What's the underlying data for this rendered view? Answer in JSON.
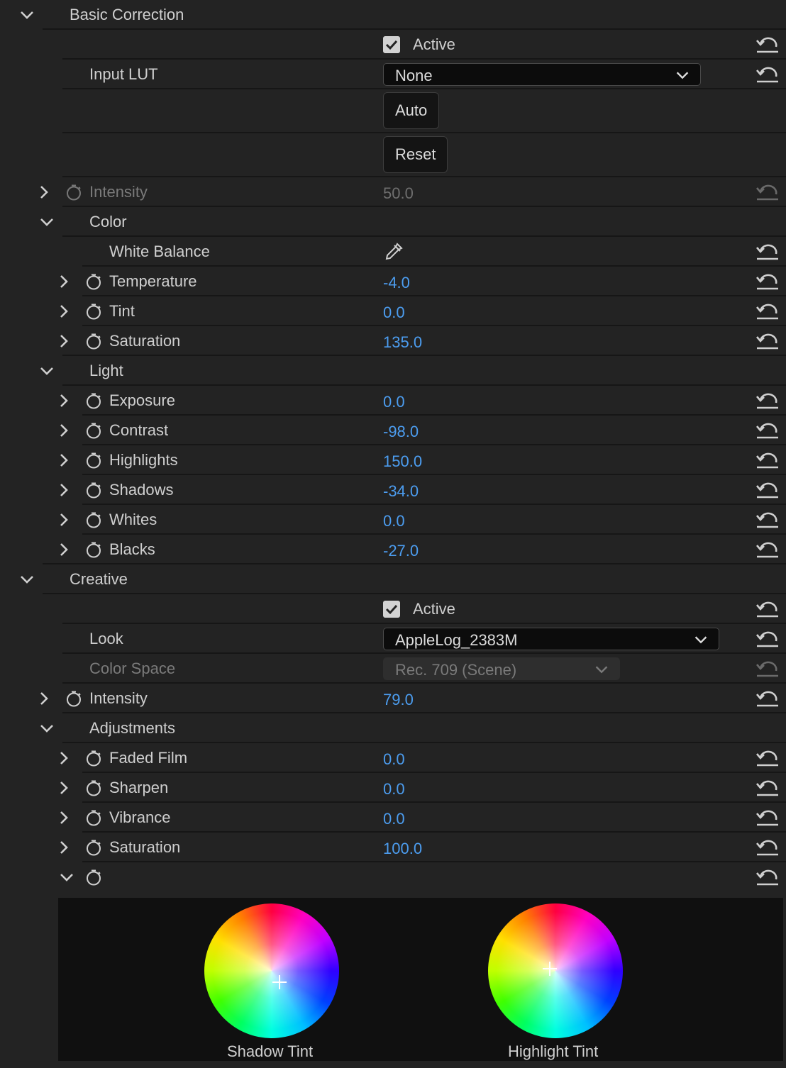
{
  "basic_correction": {
    "title": "Basic Correction",
    "active_label": "Active",
    "input_lut_label": "Input LUT",
    "input_lut_value": "None",
    "auto_label": "Auto",
    "reset_label": "Reset",
    "intensity_label": "Intensity",
    "intensity_value": "50.0",
    "color": {
      "title": "Color",
      "white_balance_label": "White Balance",
      "temperature_label": "Temperature",
      "temperature_value": "-4.0",
      "tint_label": "Tint",
      "tint_value": "0.0",
      "saturation_label": "Saturation",
      "saturation_value": "135.0"
    },
    "light": {
      "title": "Light",
      "exposure_label": "Exposure",
      "exposure_value": "0.0",
      "contrast_label": "Contrast",
      "contrast_value": "-98.0",
      "highlights_label": "Highlights",
      "highlights_value": "150.0",
      "shadows_label": "Shadows",
      "shadows_value": "-34.0",
      "whites_label": "Whites",
      "whites_value": "0.0",
      "blacks_label": "Blacks",
      "blacks_value": "-27.0"
    }
  },
  "creative": {
    "title": "Creative",
    "active_label": "Active",
    "look_label": "Look",
    "look_value": "AppleLog_2383M",
    "color_space_label": "Color Space",
    "color_space_value": "Rec. 709 (Scene)",
    "intensity_label": "Intensity",
    "intensity_value": "79.0",
    "adjustments": {
      "title": "Adjustments",
      "faded_film_label": "Faded Film",
      "faded_film_value": "0.0",
      "sharpen_label": "Sharpen",
      "sharpen_value": "0.0",
      "vibrance_label": "Vibrance",
      "vibrance_value": "0.0",
      "saturation_label": "Saturation",
      "saturation_value": "100.0"
    },
    "shadow_tint_label": "Shadow Tint",
    "highlight_tint_label": "Highlight Tint"
  },
  "colors": {
    "background": "#232323",
    "value_blue": "#4c9df0",
    "disabled_text": "#7a7a7a"
  },
  "icons": [
    "chevron-down-icon",
    "chevron-right-icon",
    "stopwatch-icon",
    "reset-icon",
    "eyedropper-icon",
    "checkmark-icon",
    "plus-icon"
  ]
}
